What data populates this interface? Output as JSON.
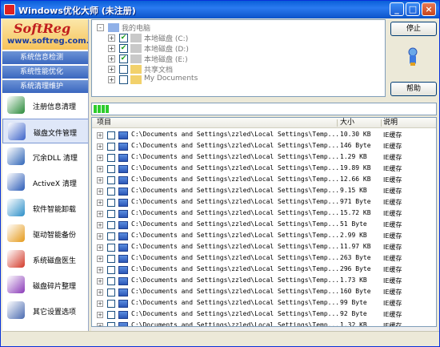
{
  "window": {
    "title": "Windows优化大师 (未注册)",
    "controls": [
      "_",
      "□",
      "×"
    ]
  },
  "logo": {
    "brand": "SoftReg",
    "url": "www.softreg.com.cn"
  },
  "nav_sections": [
    "系统信息检测",
    "系统性能优化",
    "系统清理维护"
  ],
  "menu": [
    {
      "label": "注册信息清理",
      "icon": "registry-icon",
      "color": "#2a8a3a"
    },
    {
      "label": "磁盘文件管理",
      "icon": "disk-icon",
      "color": "#3b62c9",
      "active": true
    },
    {
      "label": "冗余DLL 清理",
      "icon": "dll-icon",
      "color": "#3066b8"
    },
    {
      "label": "ActiveX 清理",
      "icon": "activex-icon",
      "color": "#2a5bb7"
    },
    {
      "label": "软件智能卸载",
      "icon": "uninstall-icon",
      "color": "#2c8fc8"
    },
    {
      "label": "驱动智能备份",
      "icon": "driver-backup-icon",
      "color": "#e59a1a"
    },
    {
      "label": "系统磁盘医生",
      "icon": "disk-doctor-icon",
      "color": "#d33a2a"
    },
    {
      "label": "磁盘碎片整理",
      "icon": "defrag-icon",
      "color": "#8a3ab8"
    },
    {
      "label": "其它设置选项",
      "icon": "settings-icon",
      "color": "#4a6ab0"
    }
  ],
  "tree": [
    {
      "label": "我的电脑",
      "level": 0,
      "expander": "-",
      "checkbox": false,
      "icon": "computer-icon"
    },
    {
      "label": "本地磁盘 (C:)",
      "level": 1,
      "expander": "+",
      "checkbox": true,
      "checked": true,
      "icon": "drive-icon"
    },
    {
      "label": "本地磁盘 (D:)",
      "level": 1,
      "expander": "+",
      "checkbox": true,
      "checked": true,
      "icon": "drive-icon"
    },
    {
      "label": "本地磁盘 (E:)",
      "level": 1,
      "expander": "+",
      "checkbox": true,
      "checked": true,
      "icon": "drive-icon"
    },
    {
      "label": "共享文档",
      "level": 1,
      "expander": "+",
      "checkbox": true,
      "checked": false,
      "icon": "folder-icon"
    },
    {
      "label": "My Documents",
      "level": 1,
      "expander": "+",
      "checkbox": true,
      "checked": false,
      "icon": "folder-icon"
    }
  ],
  "buttons": {
    "stop": "停止",
    "help": "帮助"
  },
  "progress": {
    "segments": 4
  },
  "list": {
    "columns": [
      "项目",
      "大小",
      "说明"
    ],
    "rows": [
      {
        "path": "C:\\Documents and Settings\\zzled\\Local Settings\\Temp...",
        "size": "10.30 KB",
        "desc": "IE缓存"
      },
      {
        "path": "C:\\Documents and Settings\\zzled\\Local Settings\\Temp...",
        "size": "146 Byte",
        "desc": "IE缓存"
      },
      {
        "path": "C:\\Documents and Settings\\zzled\\Local Settings\\Temp...",
        "size": "1.29 KB",
        "desc": "IE缓存"
      },
      {
        "path": "C:\\Documents and Settings\\zzled\\Local Settings\\Temp...",
        "size": "19.89 KB",
        "desc": "IE缓存"
      },
      {
        "path": "C:\\Documents and Settings\\zzled\\Local Settings\\Temp...",
        "size": "12.66 KB",
        "desc": "IE缓存"
      },
      {
        "path": "C:\\Documents and Settings\\zzled\\Local Settings\\Temp...",
        "size": "9.15 KB",
        "desc": "IE缓存"
      },
      {
        "path": "C:\\Documents and Settings\\zzled\\Local Settings\\Temp...",
        "size": "971 Byte",
        "desc": "IE缓存"
      },
      {
        "path": "C:\\Documents and Settings\\zzled\\Local Settings\\Temp...",
        "size": "15.72 KB",
        "desc": "IE缓存"
      },
      {
        "path": "C:\\Documents and Settings\\zzled\\Local Settings\\Temp...",
        "size": "51 Byte",
        "desc": "IE缓存"
      },
      {
        "path": "C:\\Documents and Settings\\zzled\\Local Settings\\Temp...",
        "size": "2.99 KB",
        "desc": "IE缓存"
      },
      {
        "path": "C:\\Documents and Settings\\zzled\\Local Settings\\Temp...",
        "size": "11.97 KB",
        "desc": "IE缓存"
      },
      {
        "path": "C:\\Documents and Settings\\zzled\\Local Settings\\Temp...",
        "size": "263 Byte",
        "desc": "IE缓存"
      },
      {
        "path": "C:\\Documents and Settings\\zzled\\Local Settings\\Temp...",
        "size": "296 Byte",
        "desc": "IE缓存"
      },
      {
        "path": "C:\\Documents and Settings\\zzled\\Local Settings\\Temp...",
        "size": "1.73 KB",
        "desc": "IE缓存"
      },
      {
        "path": "C:\\Documents and Settings\\zzled\\Local Settings\\Temp...",
        "size": "160 Byte",
        "desc": "IE缓存"
      },
      {
        "path": "C:\\Documents and Settings\\zzled\\Local Settings\\Temp...",
        "size": "99 Byte",
        "desc": "IE缓存"
      },
      {
        "path": "C:\\Documents and Settings\\zzled\\Local Settings\\Temp...",
        "size": "92 Byte",
        "desc": "IE缓存"
      },
      {
        "path": "C:\\Documents and Settings\\zzled\\Local Settings\\Temp...",
        "size": "1.32 KB",
        "desc": "IE缓存"
      }
    ]
  }
}
